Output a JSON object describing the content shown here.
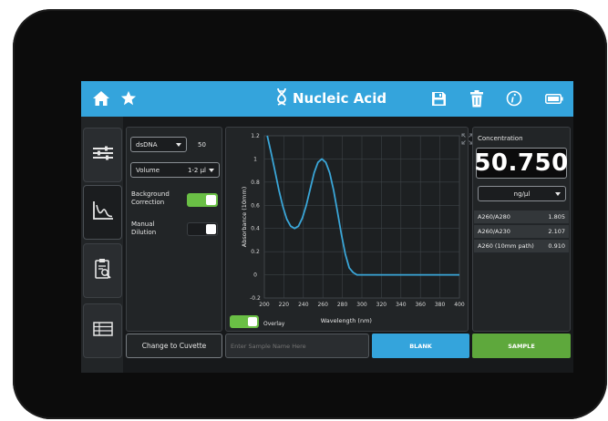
{
  "header": {
    "title": "Nucleic Acid",
    "icons": [
      "home-icon",
      "star-icon",
      "dna-icon",
      "save-icon",
      "trash-icon",
      "info-icon",
      "battery-icon"
    ]
  },
  "sidebar": {
    "items": [
      {
        "icon": "sliders-icon",
        "selected": false
      },
      {
        "icon": "chart-icon",
        "selected": true
      },
      {
        "icon": "clipboard-search-icon",
        "selected": false
      },
      {
        "icon": "table-icon",
        "selected": false
      }
    ]
  },
  "settings": {
    "sample_type": "dsDNA",
    "factor": "50",
    "volume_label": "Volume",
    "volume_value": "1-2 µl",
    "background_correction_label": "Background Correction",
    "background_correction_on": true,
    "manual_dilution_label": "Manual Dilution",
    "manual_dilution_on": false
  },
  "chart": {
    "overlay_label": "Overlay",
    "overlay_on": true,
    "expand_icon": "expand-icon"
  },
  "chart_data": {
    "type": "line",
    "title": "",
    "xlabel": "Wavelength (nm)",
    "ylabel": "Absorbance (10mm)",
    "xlim": [
      200,
      400
    ],
    "ylim": [
      -0.2,
      1.2
    ],
    "xticks": [
      "200",
      "220",
      "240",
      "260",
      "280",
      "300",
      "320",
      "340",
      "360",
      "380",
      "400"
    ],
    "yticks": [
      "1.2",
      "1",
      "0.8",
      "0.6",
      "0.4",
      "0.2",
      "0",
      "-0.2"
    ],
    "grid": true,
    "series": [
      {
        "color": "#3aa6d8",
        "x": [
          203,
          207,
          211,
          215,
          219,
          223,
          227,
          231,
          235,
          239,
          243,
          247,
          251,
          255,
          259,
          263,
          267,
          271,
          275,
          279,
          283,
          287,
          291,
          295,
          300,
          320,
          340,
          360,
          380,
          400
        ],
        "y": [
          1.2,
          1.05,
          0.89,
          0.73,
          0.59,
          0.48,
          0.42,
          0.4,
          0.42,
          0.49,
          0.6,
          0.74,
          0.88,
          0.97,
          1.0,
          0.97,
          0.88,
          0.73,
          0.54,
          0.35,
          0.18,
          0.06,
          0.02,
          0.0,
          0.0,
          0.0,
          0.0,
          0.0,
          0.0,
          0.0
        ]
      }
    ]
  },
  "results": {
    "concentration_label": "Concentration",
    "concentration_value": "50.750",
    "unit": "ng/µl",
    "ratios": [
      {
        "label": "A260/A280",
        "value": "1.805"
      },
      {
        "label": "A260/A230",
        "value": "2.107"
      },
      {
        "label": "A260 (10mm path)",
        "value": "0.910"
      }
    ]
  },
  "bottom": {
    "cuvette_button": "Change to Cuvette",
    "sample_name_placeholder": "Enter Sample Name Here",
    "blank_button": "BLANK",
    "sample_button": "SAMPLE"
  },
  "colors": {
    "accent": "#34a4dc",
    "sample_green": "#5ea83c",
    "toggle_on": "#6abf45"
  }
}
